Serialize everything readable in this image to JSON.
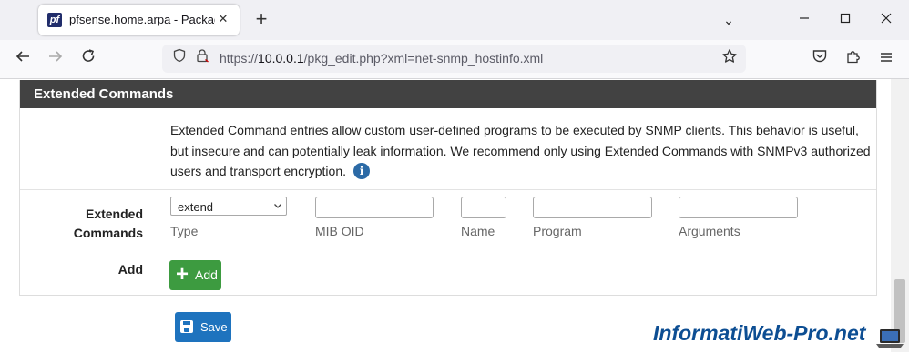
{
  "browser": {
    "tab_title": "pfsense.home.arpa - Packages: Net-SNMP",
    "url_prefix": "https://",
    "url_host": "10.0.0.1",
    "url_path": "/pkg_edit.php?xml=net-snmp_hostinfo.xml"
  },
  "panel": {
    "title": "Extended Commands",
    "info_text": "Extended Command entries allow custom user-defined programs to be executed by SNMP clients. This behavior is useful, but insecure and can potentially leak information. We recommend only using Extended Commands with SNMPv3 authorized users and transport encryption.",
    "row_label": "Extended Commands",
    "type_value": "extend",
    "field_labels": {
      "type": "Type",
      "mib_oid": "MIB OID",
      "name": "Name",
      "program": "Program",
      "arguments": "Arguments"
    },
    "add_row_label": "Add",
    "add_button": "Add"
  },
  "save_button": "Save",
  "watermark": "InformatiWeb-Pro.net",
  "colors": {
    "panel_heading": "#424242",
    "add_button": "#3d9b40",
    "save_button": "#1e73be",
    "watermark": "#0d4e93"
  }
}
